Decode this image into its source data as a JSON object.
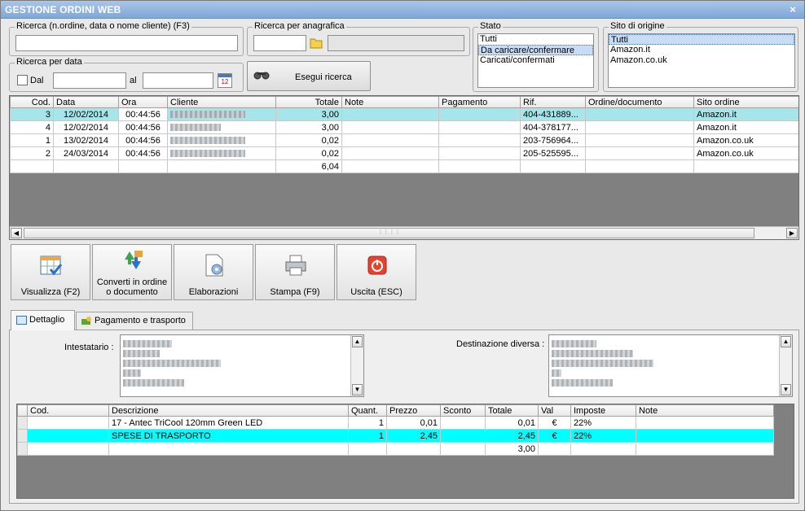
{
  "window": {
    "title": "GESTIONE ORDINI WEB",
    "close": "×"
  },
  "search": {
    "label": "Ricerca (n.ordine, data o nome cliente) (F3)",
    "value": ""
  },
  "anagrafica": {
    "label": "Ricerca per anagrafica",
    "value": ""
  },
  "stato": {
    "label": "Stato",
    "options": [
      "Tutti",
      "Da caricare/confermare",
      "Caricati/confermati"
    ],
    "selected": "Da caricare/confermare"
  },
  "sito": {
    "label": "Sito di origine",
    "options": [
      "Tutti",
      "Amazon.it",
      "Amazon.co.uk"
    ],
    "selected": "Tutti"
  },
  "date_search": {
    "label": "Ricerca per data",
    "from_label": "Dal",
    "to_label": "al",
    "from_value": "",
    "to_value": "",
    "calendar_day": "12"
  },
  "run_search": {
    "label": "Esegui ricerca"
  },
  "orders": {
    "columns": [
      "Cod.",
      "Data",
      "Ora",
      "Cliente",
      "Totale",
      "Note",
      "Pagamento",
      "Rif.",
      "Ordine/documento",
      "Sito ordine"
    ],
    "rows": [
      {
        "cod": "3",
        "data": "12/02/2014",
        "ora": "00:44:56",
        "totale": "3,00",
        "note": "",
        "pagamento": "",
        "rif": "404-431889...",
        "ordine": "",
        "sito": "Amazon.it"
      },
      {
        "cod": "4",
        "data": "12/02/2014",
        "ora": "00:44:56",
        "totale": "3,00",
        "note": "",
        "pagamento": "",
        "rif": "404-378177...",
        "ordine": "",
        "sito": "Amazon.it"
      },
      {
        "cod": "1",
        "data": "13/02/2014",
        "ora": "00:44:56",
        "totale": "0,02",
        "note": "",
        "pagamento": "",
        "rif": "203-756964...",
        "ordine": "",
        "sito": "Amazon.co.uk"
      },
      {
        "cod": "2",
        "data": "24/03/2014",
        "ora": "00:44:56",
        "totale": "0,02",
        "note": "",
        "pagamento": "",
        "rif": "205-525595...",
        "ordine": "",
        "sito": "Amazon.co.uk"
      }
    ],
    "total": "6,04"
  },
  "toolbar": {
    "visualizza": "Visualizza (F2)",
    "converti_1": "Converti in ordine",
    "converti_2": "o documento",
    "elaborazioni": "Elaborazioni",
    "stampa": "Stampa (F9)",
    "uscita": "Uscita (ESC)"
  },
  "tabs": {
    "dettaglio": "Dettaglio",
    "pagamento": "Pagamento e trasporto"
  },
  "detail": {
    "intestatario_label": "Intestatario :",
    "destinazione_label": "Destinazione diversa :"
  },
  "items": {
    "columns": [
      "Cod.",
      "Descrizione",
      "Quant.",
      "Prezzo",
      "Sconto",
      "Totale",
      "Val",
      "Imposte",
      "Note"
    ],
    "rows": [
      {
        "cod": "",
        "descrizione": "17 - Antec  TriCool 120mm Green LED",
        "quant": "1",
        "prezzo": "0,01",
        "sconto": "",
        "totale": "0,01",
        "val": "€",
        "imposte": "22%",
        "note": ""
      },
      {
        "cod": "",
        "descrizione": "SPESE DI TRASPORTO",
        "quant": "1",
        "prezzo": "2,45",
        "sconto": "",
        "totale": "2,45",
        "val": "€",
        "imposte": "22%",
        "note": ""
      }
    ],
    "total": "3,00"
  },
  "colors": {
    "title_bg": "#8fb1dc",
    "row_highlight": "#a6e6ea",
    "item_highlight": "#00ffff",
    "grey_area": "#808080"
  }
}
